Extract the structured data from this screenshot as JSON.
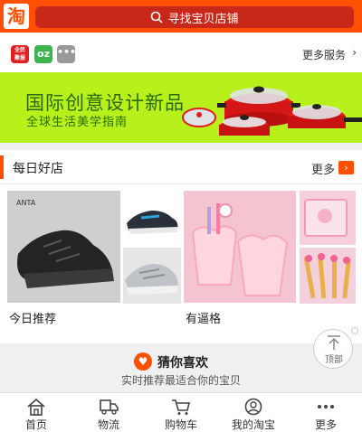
{
  "header": {
    "logo_text": "淘",
    "search_placeholder": "寻找宝贝店铺"
  },
  "services": {
    "icons": [
      {
        "name": "quanmin-jubao-icon",
        "text": "全民\n聚报"
      },
      {
        "name": "o2o-icon",
        "text": "oz"
      },
      {
        "name": "more-dots-icon",
        "text": "•••"
      }
    ],
    "more_label": "更多服务",
    "chevron": "›"
  },
  "banner": {
    "title": "国际创意设计新品",
    "subtitle": "全球生活美学指南"
  },
  "daily_shop": {
    "title": "每日好店",
    "more_label": "更多",
    "more_arrow": "›",
    "captions": [
      "今日推荐",
      "有逼格"
    ]
  },
  "guess": {
    "icon": "♥",
    "title": "猜你喜欢",
    "subtitle": "实时推荐最适合你的宝贝"
  },
  "back_to_top": {
    "label": "顶部"
  },
  "tabbar": {
    "tabs": [
      {
        "label": "首页",
        "icon": "home-icon"
      },
      {
        "label": "物流",
        "icon": "truck-icon"
      },
      {
        "label": "购物车",
        "icon": "cart-icon"
      },
      {
        "label": "我的淘宝",
        "icon": "user-icon"
      },
      {
        "label": "更多",
        "icon": "more-icon"
      }
    ]
  },
  "colors": {
    "brand": "#ff5000",
    "banner_bg": "#b7f01a",
    "banner_text": "#2b6a0e"
  }
}
